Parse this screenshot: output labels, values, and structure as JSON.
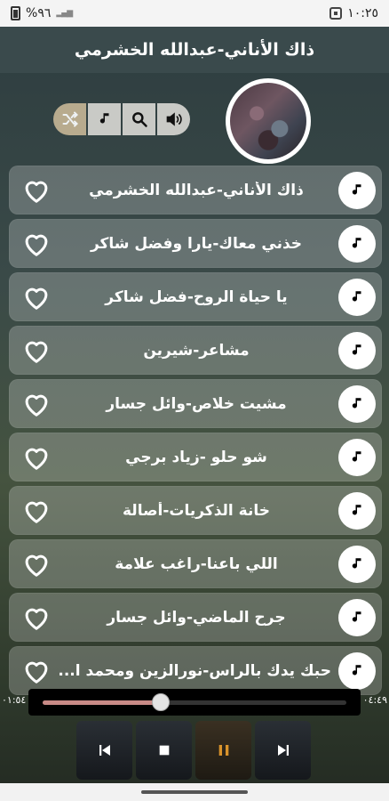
{
  "status_bar": {
    "time": "١٠:٢٥",
    "battery": "%٩٦"
  },
  "header": {
    "title": "ذاك الأناني-عبدالله الخشرمي"
  },
  "songs": [
    {
      "title": "ذاك الأناني-عبدالله الخشرمي"
    },
    {
      "title": "خذني معاك-يارا وفضل شاكر"
    },
    {
      "title": "يا حياة الروح-فضل شاكر"
    },
    {
      "title": "مشاعر-شيرين"
    },
    {
      "title": "مشيت خلاص-وائل جسار"
    },
    {
      "title": "شو حلو -زياد برجي"
    },
    {
      "title": "خانة الذكريات-أصالة"
    },
    {
      "title": "اللي باعنا-راغب علامة"
    },
    {
      "title": "جرح الماضي-وائل جسار"
    },
    {
      "title": "حبك يدك بالراس-نورالزين ومحمد ا..."
    }
  ],
  "player": {
    "current_time": "٠٤:٤٩",
    "total_time": "٠١:٥٤",
    "progress": 0.39,
    "state": "playing"
  },
  "colors": {
    "title_bar": "#3a4a4c",
    "shuffle_accent": "#b8ab8e",
    "progress_fill": "#c88a86",
    "pause_accent": "#d9932b"
  }
}
